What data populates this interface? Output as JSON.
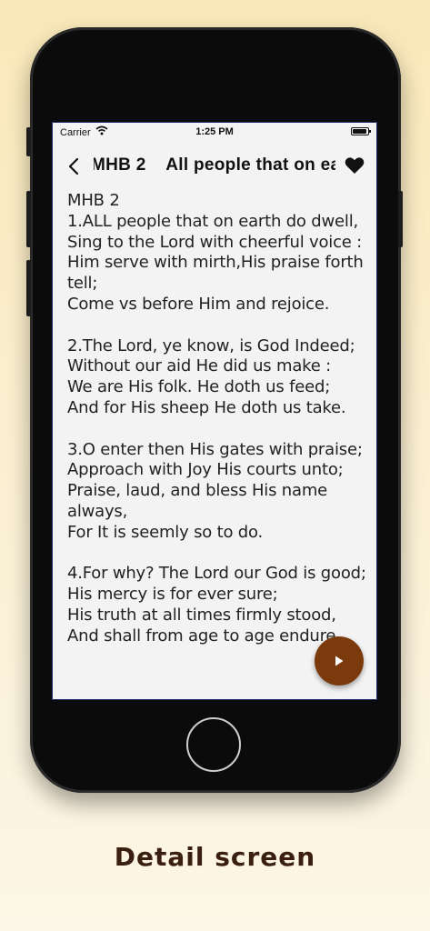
{
  "status_bar": {
    "carrier": "Carrier",
    "time": "1:25 PM"
  },
  "app_bar": {
    "title": "MHB 2    All people that on ea"
  },
  "hymn": {
    "text": "MHB 2\n1.ALL people that on earth do dwell,\nSing to the Lord with cheerful voice :\nHim serve with mirth,His praise forth tell;\nCome vs before Him and rejoice.\n\n2.The Lord, ye know, is God Indeed;\nWithout our aid He did us make :\nWe are His folk. He doth us feed;\nAnd for His sheep He doth us take.\n\n3.O enter then His gates with praise;\nApproach with Joy His courts unto;\nPraise, laud, and bless His name always,\nFor It is seemly so to do.\n\n4.For why? The Lord our God is good;\nHis mercy is for ever sure;\nHis truth at all times firmly stood,\nAnd shall from age to age endure."
  },
  "caption": "Detail screen",
  "colors": {
    "accent": "#7a3a0c",
    "background": "#f9e8b8",
    "caption": "#3a1f10"
  }
}
